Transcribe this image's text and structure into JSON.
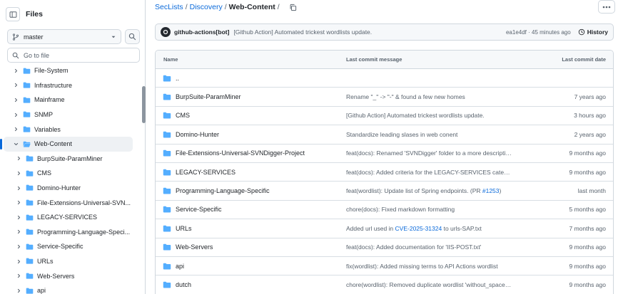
{
  "sidebar": {
    "title": "Files",
    "branch": "master",
    "goto_placeholder": "Go to file",
    "tree": [
      {
        "label": "File-System",
        "level": 0,
        "expanded": false
      },
      {
        "label": "Infrastructure",
        "level": 0,
        "expanded": false
      },
      {
        "label": "Mainframe",
        "level": 0,
        "expanded": false
      },
      {
        "label": "SNMP",
        "level": 0,
        "expanded": false
      },
      {
        "label": "Variables",
        "level": 0,
        "expanded": false
      },
      {
        "label": "Web-Content",
        "level": 0,
        "expanded": true,
        "active": true
      },
      {
        "label": "BurpSuite-ParamMiner",
        "level": 1,
        "expanded": false
      },
      {
        "label": "CMS",
        "level": 1,
        "expanded": false
      },
      {
        "label": "Domino-Hunter",
        "level": 1,
        "expanded": false
      },
      {
        "label": "File-Extensions-Universal-SVN...",
        "level": 1,
        "expanded": false
      },
      {
        "label": "LEGACY-SERVICES",
        "level": 1,
        "expanded": false
      },
      {
        "label": "Programming-Language-Speci...",
        "level": 1,
        "expanded": false
      },
      {
        "label": "Service-Specific",
        "level": 1,
        "expanded": false
      },
      {
        "label": "URLs",
        "level": 1,
        "expanded": false
      },
      {
        "label": "Web-Servers",
        "level": 1,
        "expanded": false
      },
      {
        "label": "api",
        "level": 1,
        "expanded": false
      }
    ]
  },
  "breadcrumb": {
    "repo": "SecLists",
    "folder": "Discovery",
    "current": "Web-Content",
    "trailing_sep": "/"
  },
  "latest_commit": {
    "author": "github-actions[bot]",
    "message": "[Github Action] Automated trickest wordlists update.",
    "hash_time": "ea1e4df · 45 minutes ago",
    "history_label": "History"
  },
  "table": {
    "headers": {
      "name": "Name",
      "message": "Last commit message",
      "date": "Last commit date"
    },
    "rows": [
      {
        "name": "..",
        "message": "",
        "date": ""
      },
      {
        "name": "BurpSuite-ParamMiner",
        "message": "Rename \"_\" -> \"-\" & found a few new homes",
        "date": "7 years ago"
      },
      {
        "name": "CMS",
        "message": "[Github Action] Automated trickest wordlists update.",
        "date": "3 hours ago"
      },
      {
        "name": "Domino-Hunter",
        "message": "Standardize leading slases in web conent",
        "date": "2 years ago"
      },
      {
        "name": "File-Extensions-Universal-SVNDigger-Project",
        "message": "feat(docs): Renamed 'SVNDigger' folder to a more descriptive folder n...",
        "date": "9 months ago"
      },
      {
        "name": "LEGACY-SERVICES",
        "message": "feat(docs): Added criteria for the LEGACY-SERVICES category",
        "date": "9 months ago"
      },
      {
        "name": "Programming-Language-Specific",
        "message": "feat(wordlist): Update list of Spring endpoints. (PR ",
        "link": "#1253",
        "message_end": ")",
        "date": "last month"
      },
      {
        "name": "Service-Specific",
        "message": "chore(docs): Fixed markdown formatting",
        "date": "5 months ago"
      },
      {
        "name": "URLs",
        "message": "Added url used in ",
        "link": "CVE-2025-31324",
        "message_end": " to urls-SAP.txt",
        "date": "7 months ago"
      },
      {
        "name": "Web-Servers",
        "message": "feat(docs): Added documentation for 'IIS-POST.txt'",
        "date": "9 months ago"
      },
      {
        "name": "api",
        "message": "fix(wordlist): Added missing terms to API Actions wordlist",
        "date": "9 months ago"
      },
      {
        "name": "dutch",
        "message": "chore(wordlist): Removed duplicate wordlist 'without_spaces.txt'",
        "date": "9 months ago"
      }
    ]
  },
  "colors": {
    "accent": "#0969da",
    "folder": "#54aeff",
    "border": "#d0d7de"
  }
}
